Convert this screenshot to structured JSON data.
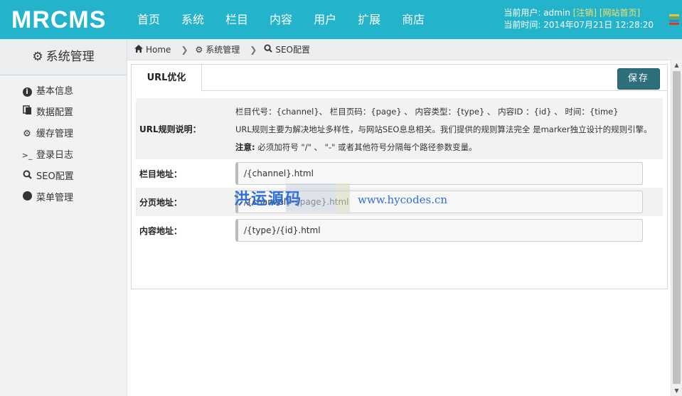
{
  "app": {
    "logo": "MRCMS"
  },
  "nav": [
    {
      "label": "首页"
    },
    {
      "label": "系统"
    },
    {
      "label": "栏目"
    },
    {
      "label": "内容"
    },
    {
      "label": "用户"
    },
    {
      "label": "扩展"
    },
    {
      "label": "商店"
    }
  ],
  "user": {
    "current_user_label": "当前用户: admin",
    "logout": "[注销]",
    "site_home": "[网站首页]",
    "time_label": "当前时间: 2014年07月21日 12:28:20"
  },
  "colors": {
    "topbar": "#23b4cc",
    "save_button": "#2e6f7c",
    "link_yellow": "#f5e06a",
    "stack_icon": [
      "#f1c232",
      "#6aa84f",
      "#3d85c6",
      "#cc4125"
    ]
  },
  "sidebar": {
    "title": "系统管理",
    "title_icon": "gear-icon",
    "items": [
      {
        "label": "基本信息",
        "icon": "info-icon"
      },
      {
        "label": "数据配置",
        "icon": "database-icon"
      },
      {
        "label": "缓存管理",
        "icon": "cogs-icon"
      },
      {
        "label": "登录日志",
        "icon": "terminal-icon"
      },
      {
        "label": "SEO配置",
        "icon": "search-icon"
      },
      {
        "label": "菜单管理",
        "icon": "circle-icon"
      }
    ]
  },
  "breadcrumb": [
    {
      "label": "Home",
      "icon": "home-icon"
    },
    {
      "label": "系统管理",
      "icon": "gear-icon"
    },
    {
      "label": "SEO配置",
      "icon": "search-icon"
    }
  ],
  "panel": {
    "tab": "URL优化",
    "save_label": "保存",
    "desc_label": "URL规则说明：",
    "desc_line1": "栏目代号：{channel}、 栏目页码：{page} 、 内容类型：{type} 、 内容ID ：{id} 、 时间：{time}",
    "desc_line2": "URL规则主要为解决地址多样性，与网站SEO息息相关。我们提供的规则算法完全 是marker独立设计的规则引擎。",
    "desc_note_label": "注意:",
    "desc_note": " 必须加符号 \"/\" 、 \"-\" 或者其他符号分隔每个路径参数变量。",
    "fields": [
      {
        "label": "栏目地址：",
        "value": "/{channel}.html"
      },
      {
        "label": "分页地址：",
        "value": "/{channel}-{page}.html"
      },
      {
        "label": "内容地址：",
        "value": "/{type}/{id}.html"
      }
    ]
  },
  "watermark": {
    "text": "洪运源码",
    "url": "www.hycodes.cn"
  }
}
